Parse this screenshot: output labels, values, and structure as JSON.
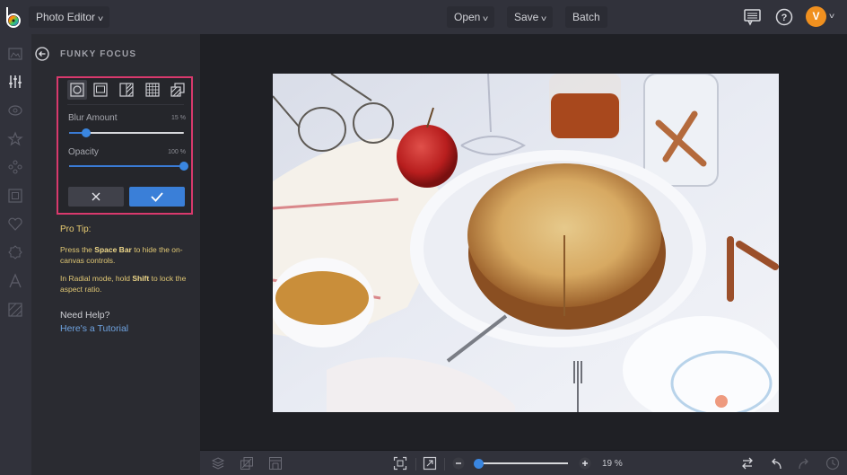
{
  "header": {
    "app_menu_label": "Photo Editor",
    "open_label": "Open",
    "save_label": "Save",
    "batch_label": "Batch",
    "avatar_initial": "V"
  },
  "left_rail": {
    "items": [
      "image-icon",
      "sliders-icon",
      "eye-icon",
      "star-icon",
      "flower-icon",
      "frame-icon",
      "heart-icon",
      "badge-icon",
      "text-icon",
      "texture-icon"
    ],
    "active": "sliders-icon"
  },
  "panel": {
    "title": "FUNKY FOCUS",
    "modes": [
      "radial",
      "rectangle",
      "half",
      "grid",
      "layered"
    ],
    "active_mode": "radial",
    "blur": {
      "label": "Blur Amount",
      "value_text": "15 %",
      "value": 15
    },
    "opacity": {
      "label": "Opacity",
      "value_text": "100 %",
      "value": 100
    },
    "pro_tip_title": "Pro Tip:",
    "tip1": {
      "a": "Press the ",
      "b": "Space Bar",
      "c": " to hide the on-canvas controls."
    },
    "tip2": {
      "a": "In Radial mode, hold ",
      "b": "Shift",
      "c": " to lock the aspect ratio."
    },
    "help_title": "Need Help?",
    "help_link": "Here's a Tutorial"
  },
  "bottom": {
    "zoom_text": "19 %",
    "zoom_value": 19
  },
  "colors": {
    "accent": "#3a7fd8",
    "highlight_border": "#d9396d",
    "tip_text": "#e0c774",
    "avatar": "#f0901f"
  }
}
